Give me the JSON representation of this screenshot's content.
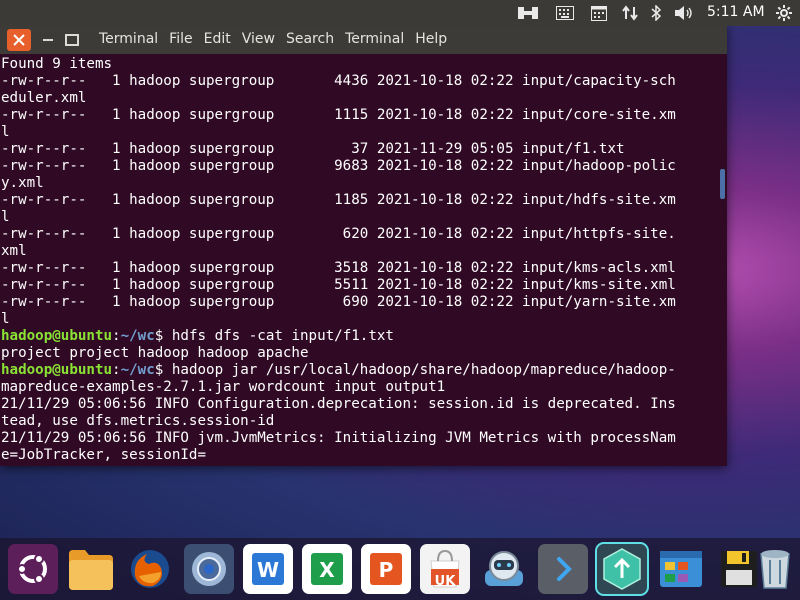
{
  "top_panel": {
    "indicators": [
      "keyboard-layout-icon",
      "keyboard-icon",
      "calendar-icon",
      "network-transfer-icon",
      "bluetooth-icon",
      "volume-icon",
      "settings-gear-icon"
    ],
    "clock": "5:11 AM"
  },
  "window": {
    "menu": [
      "Terminal",
      "File",
      "Edit",
      "View",
      "Search",
      "Terminal",
      "Help"
    ],
    "buttons": [
      "close-icon",
      "minimize-icon",
      "maximize-icon"
    ]
  },
  "terminal": {
    "lines": [
      {
        "text": "Found 9 items"
      },
      {
        "text": "-rw-r--r--   1 hadoop supergroup       4436 2021-10-18 02:22 input/capacity-sch"
      },
      {
        "text": "eduler.xml"
      },
      {
        "text": "-rw-r--r--   1 hadoop supergroup       1115 2021-10-18 02:22 input/core-site.xm"
      },
      {
        "text": "l"
      },
      {
        "text": "-rw-r--r--   1 hadoop supergroup         37 2021-11-29 05:05 input/f1.txt"
      },
      {
        "text": "-rw-r--r--   1 hadoop supergroup       9683 2021-10-18 02:22 input/hadoop-polic"
      },
      {
        "text": "y.xml"
      },
      {
        "text": "-rw-r--r--   1 hadoop supergroup       1185 2021-10-18 02:22 input/hdfs-site.xm"
      },
      {
        "text": "l"
      },
      {
        "text": "-rw-r--r--   1 hadoop supergroup        620 2021-10-18 02:22 input/httpfs-site."
      },
      {
        "text": "xml"
      },
      {
        "text": "-rw-r--r--   1 hadoop supergroup       3518 2021-10-18 02:22 input/kms-acls.xml"
      },
      {
        "text": "-rw-r--r--   1 hadoop supergroup       5511 2021-10-18 02:22 input/kms-site.xml"
      },
      {
        "text": "-rw-r--r--   1 hadoop supergroup        690 2021-10-18 02:22 input/yarn-site.xm"
      },
      {
        "text": "l"
      },
      {
        "user": "hadoop@ubuntu",
        "sep": ":",
        "path": "~/wc",
        "prompt": "$ ",
        "cmd": "hdfs dfs -cat input/f1.txt"
      },
      {
        "text": "project project hadoop hadoop apache"
      },
      {
        "user": "hadoop@ubuntu",
        "sep": ":",
        "path": "~/wc",
        "prompt": "$ ",
        "cmd": "hadoop jar /usr/local/hadoop/share/hadoop/mapreduce/hadoop-"
      },
      {
        "text": "mapreduce-examples-2.7.1.jar wordcount input output1"
      },
      {
        "text": "21/11/29 05:06:56 INFO Configuration.deprecation: session.id is deprecated. Ins"
      },
      {
        "text": "tead, use dfs.metrics.session-id"
      },
      {
        "text": "21/11/29 05:06:56 INFO jvm.JvmMetrics: Initializing JVM Metrics with processNam"
      },
      {
        "text": "e=JobTracker, sessionId="
      }
    ]
  },
  "dock": {
    "items": [
      {
        "icon": "ubuntu-logo-icon",
        "colors": [
          "#5c1f5a",
          "#ffffff"
        ]
      },
      {
        "icon": "files-folder-icon",
        "colors": [
          "#f3b545",
          "#e89b28"
        ]
      },
      {
        "icon": "firefox-icon",
        "colors": [
          "#e66000",
          "#1b4b8f"
        ]
      },
      {
        "icon": "system-update-icon",
        "colors": [
          "#4b6a9a",
          "#9fb7d6"
        ]
      },
      {
        "icon": "wps-writer-icon",
        "colors": [
          "#2b78d6",
          "#ffffff"
        ]
      },
      {
        "icon": "wps-spreadsheet-icon",
        "colors": [
          "#1e9e4a",
          "#ffffff"
        ]
      },
      {
        "icon": "wps-presentation-icon",
        "colors": [
          "#e4551f",
          "#ffffff"
        ]
      },
      {
        "icon": "ubuntu-software-icon",
        "colors": [
          "#f3f3f3",
          "#e2552a"
        ],
        "label": "UK"
      },
      {
        "icon": "remmina-icon",
        "colors": [
          "#5aa0d8",
          "#ffffff"
        ]
      },
      {
        "icon": "terminal-icon",
        "colors": [
          "#525660",
          "#41a6f2"
        ]
      },
      {
        "icon": "upload-app-icon",
        "colors": [
          "#3ec1a6",
          "#ffffff"
        ]
      },
      {
        "icon": "window-manager-icon",
        "colors": [
          "#3b8fd6",
          "#f1c232"
        ]
      },
      {
        "icon": "save-floppy-icon",
        "colors": [
          "#1e1e1e",
          "#f2c52d"
        ]
      },
      {
        "icon": "trash-icon",
        "colors": [
          "#cdd8df",
          "#5c7f99"
        ]
      }
    ]
  }
}
